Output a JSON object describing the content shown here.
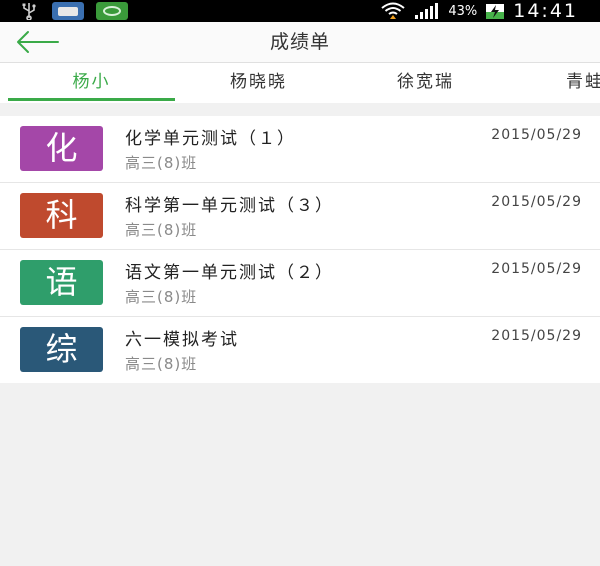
{
  "status_bar": {
    "battery_percent": "43%",
    "time": "14:41",
    "icons": [
      "usb-icon",
      "app-notification-icon",
      "wechat-notification-icon",
      "wifi-icon",
      "signal-icon",
      "battery-charging-icon"
    ]
  },
  "header": {
    "title": "成绩单",
    "back_icon": "arrow-left-icon"
  },
  "tabs": [
    {
      "label": "杨小",
      "active": true
    },
    {
      "label": "杨晓晓",
      "active": false
    },
    {
      "label": "徐宽瑞",
      "active": false
    },
    {
      "label": "青蛙",
      "active": false
    }
  ],
  "list": [
    {
      "badge": "化",
      "badge_color": "#a447a8",
      "title": "化学单元测试（１）",
      "class_name": "高三(8)班",
      "date": "2015/05/29"
    },
    {
      "badge": "科",
      "badge_color": "#bf4a2e",
      "title": "科学第一单元测试（３）",
      "class_name": "高三(8)班",
      "date": "2015/05/29"
    },
    {
      "badge": "语",
      "badge_color": "#2f9e6b",
      "title": "语文第一单元测试（２）",
      "class_name": "高三(8)班",
      "date": "2015/05/29"
    },
    {
      "badge": "综",
      "badge_color": "#2a5878",
      "title": "六一模拟考试",
      "class_name": "高三(8)班",
      "date": "2015/05/29"
    }
  ],
  "colors": {
    "accent": "#3aaa48",
    "background": "#f1f1f1"
  }
}
